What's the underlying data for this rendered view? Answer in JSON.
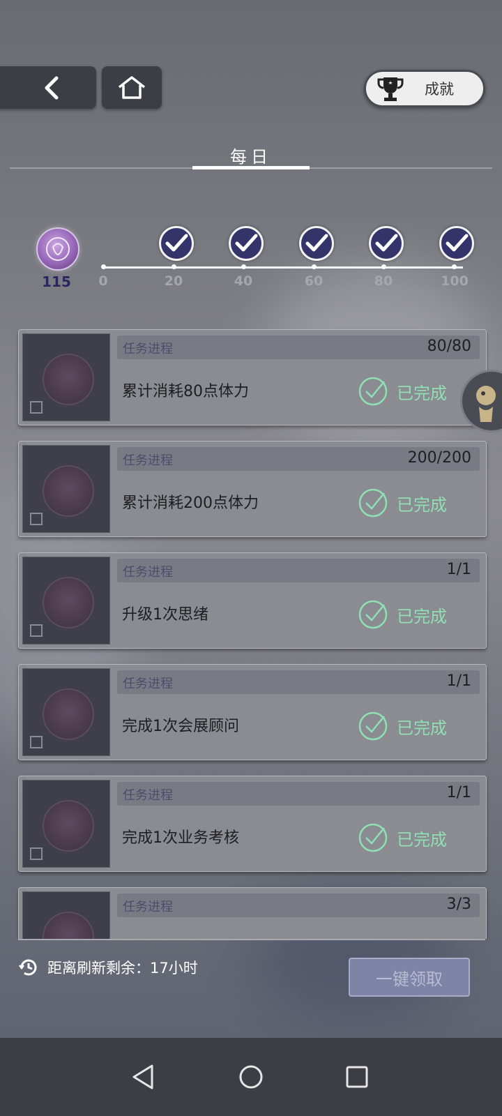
{
  "header": {
    "back_icon": "chevron-left-icon",
    "home_icon": "home-icon",
    "achievements_label": "成就",
    "achievements_icon": "trophy-icon"
  },
  "tabs": [
    {
      "label": "每日",
      "active": true
    }
  ],
  "activity": {
    "points": "115",
    "ticks": [
      "0",
      "20",
      "40",
      "60",
      "80",
      "100"
    ],
    "milestones_claimed": [
      true,
      true,
      true,
      true,
      true
    ]
  },
  "tasks": [
    {
      "progress_label": "任务进程",
      "progress": "80/80",
      "name": "累计消耗80点体力",
      "status": "已完成"
    },
    {
      "progress_label": "任务进程",
      "progress": "200/200",
      "name": "累计消耗200点体力",
      "status": "已完成"
    },
    {
      "progress_label": "任务进程",
      "progress": "1/1",
      "name": "升级1次思绪",
      "status": "已完成"
    },
    {
      "progress_label": "任务进程",
      "progress": "1/1",
      "name": "完成1次会展顾问",
      "status": "已完成"
    },
    {
      "progress_label": "任务进程",
      "progress": "1/1",
      "name": "完成1次业务考核",
      "status": "已完成"
    },
    {
      "progress_label": "任务进程",
      "progress": "3/3",
      "name": "",
      "status": ""
    }
  ],
  "footer": {
    "refresh_text": "距离刷新剩余：17小时",
    "claim_all_label": "一键领取"
  },
  "colors": {
    "done_green": "#8fe0b2",
    "milestone_blue": "#34346a"
  }
}
